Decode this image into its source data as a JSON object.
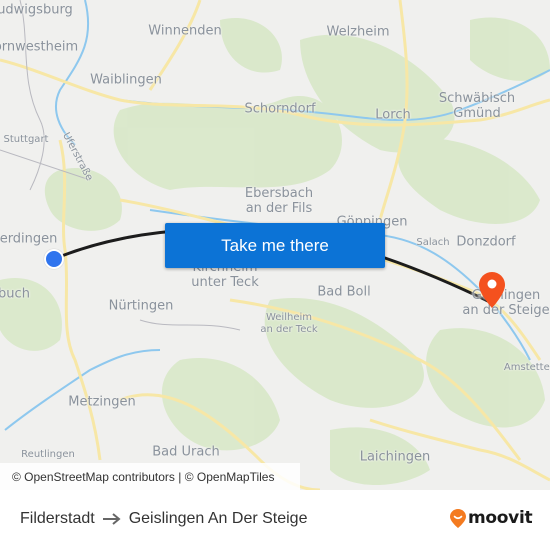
{
  "map": {
    "labels": [
      {
        "id": "ludwigsburg",
        "text": "udwigsburg"
      },
      {
        "id": "kornwestheim",
        "text": "ornwestheim"
      },
      {
        "id": "winnenden",
        "text": "Winnenden"
      },
      {
        "id": "welzheim",
        "text": "Welzheim"
      },
      {
        "id": "waiblingen",
        "text": "Waiblingen"
      },
      {
        "id": "schorndorf",
        "text": "Schorndorf"
      },
      {
        "id": "lorch",
        "text": "Lorch"
      },
      {
        "id": "schwaebisch-gmuend",
        "text": "Schwäbisch\nGmünd"
      },
      {
        "id": "stuttgart",
        "text": "Stuttgart"
      },
      {
        "id": "uferstrasse",
        "text": "Uferstraße"
      },
      {
        "id": "ebersbach",
        "text": "Ebersbach\nan der Fils"
      },
      {
        "id": "goeppingen",
        "text": "Göppingen"
      },
      {
        "id": "salach",
        "text": "Salach"
      },
      {
        "id": "donzdorf",
        "text": "Donzdorf"
      },
      {
        "id": "filderstadt-area",
        "text": "terdingen"
      },
      {
        "id": "kirchheim",
        "text": "Kirchheim\nunter Teck"
      },
      {
        "id": "bad-boll",
        "text": "Bad Boll"
      },
      {
        "id": "geislingen",
        "text": "Geislingen\nan der Steige"
      },
      {
        "id": "aichtal",
        "text": "buch"
      },
      {
        "id": "nuertingen",
        "text": "Nürtingen"
      },
      {
        "id": "weilheim",
        "text": "Weilheim\nan der Teck"
      },
      {
        "id": "amstetten",
        "text": "Amstetten"
      },
      {
        "id": "metzingen",
        "text": "Metzingen"
      },
      {
        "id": "reutlingen",
        "text": "Reutlingen"
      },
      {
        "id": "bad-urach",
        "text": "Bad Urach"
      },
      {
        "id": "laichingen",
        "text": "Laichingen"
      }
    ],
    "cta_label": "Take me there",
    "attribution": "© OpenStreetMap contributors | © OpenMapTiles",
    "route_color": "#1c1c1c",
    "origin_color": "#2f74ee",
    "destination_color": "#f4511e"
  },
  "footer": {
    "origin": "Filderstadt",
    "destination": "Geislingen An Der Steige",
    "brand": "moovit",
    "brand_color": "#f47b20"
  }
}
